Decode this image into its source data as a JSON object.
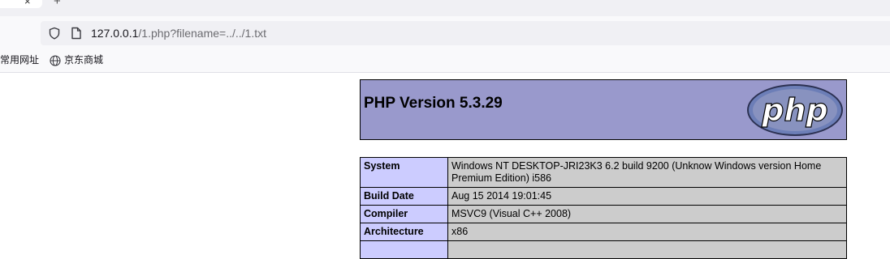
{
  "browser": {
    "tab_close_glyph": "×",
    "new_tab_glyph": "+",
    "url": {
      "host": "127.0.0.1",
      "path": "/1.php?filename=../../1.txt"
    },
    "bookmarks": [
      {
        "label": "常用网址"
      },
      {
        "label": "京东商城"
      }
    ]
  },
  "phpinfo": {
    "title": "PHP Version 5.3.29",
    "logo_text": "php",
    "rows": [
      {
        "key": "System",
        "value": "Windows NT DESKTOP-JRI23K3 6.2 build 9200 (Unknow Windows version Home Premium Edition) i586"
      },
      {
        "key": "Build Date",
        "value": "Aug 15 2014 19:01:45"
      },
      {
        "key": "Compiler",
        "value": "MSVC9 (Visual C++ 2008)"
      },
      {
        "key": "Architecture",
        "value": "x86"
      }
    ]
  },
  "colors": {
    "header_bg": "#9999cc",
    "key_bg": "#ccccff",
    "value_bg": "#cccccc",
    "logo_fill": "#6c7eb7"
  }
}
